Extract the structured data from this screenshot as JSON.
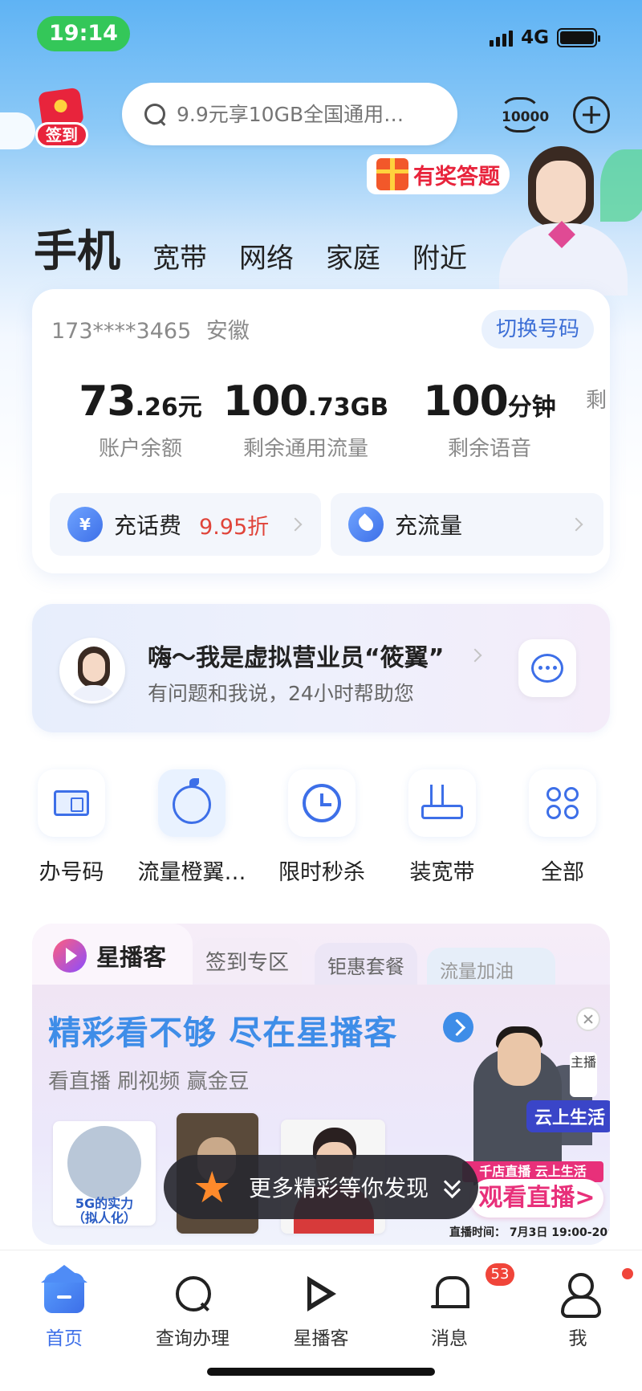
{
  "status_bar": {
    "time": "19:14",
    "network": "4G"
  },
  "header": {
    "checkin_label": "签到",
    "search_placeholder": "9.9元享10GB全国通用…",
    "hotline_label": "10000",
    "quiz_label": "有奖答题"
  },
  "top_tabs": [
    {
      "label": "手机",
      "active": true
    },
    {
      "label": "宽带"
    },
    {
      "label": "网络"
    },
    {
      "label": "家庭"
    },
    {
      "label": "附近"
    }
  ],
  "account": {
    "phone": "173****3465",
    "region": "安徽",
    "switch_label": "切换号码",
    "stats": [
      {
        "big": "73",
        "small": ".26元",
        "label": "账户余额"
      },
      {
        "big": "100",
        "small": ".73GB",
        "label": "剩余通用流量"
      },
      {
        "big": "100",
        "small": "分钟",
        "label": "剩余语音"
      },
      {
        "big": "",
        "small": "",
        "label": "剩"
      }
    ],
    "actions": [
      {
        "icon": "yuan-icon",
        "icon_text": "¥",
        "label": "充话费",
        "discount": "9.95折"
      },
      {
        "icon": "drop-icon",
        "label": "充流量"
      }
    ]
  },
  "virtual_agent": {
    "title": "嗨～我是虚拟营业员“筱翼”",
    "subtitle": "有问题和我说，24小时帮助您"
  },
  "services": [
    {
      "icon": "sim-card-icon",
      "label": "办号码"
    },
    {
      "icon": "orange-icon",
      "label": "流量橙翼…"
    },
    {
      "icon": "clock-icon",
      "label": "限时秒杀"
    },
    {
      "icon": "router-icon",
      "label": "装宽带"
    },
    {
      "icon": "grid-icon",
      "label": "全部"
    }
  ],
  "live": {
    "brand": "星播客",
    "tabs": [
      "签到专区",
      "钜惠套餐",
      "流量加油"
    ],
    "headline": "精彩看不够 尽在星播客",
    "subline": "看直播 刷视频 赢金豆",
    "thumb1_caption": "5G的实力\n（拟人化）",
    "promo": {
      "host_badge": "主播",
      "cloud_tag": "云上生活",
      "banner": "千店直播  云上生活",
      "watch_label": "观看直播>",
      "time_text": "直播时间：  7月3日 19:00-20:30"
    },
    "discover_label": "更多精彩等你发现"
  },
  "bottom_nav": [
    {
      "label": "首页",
      "icon": "home-icon",
      "active": true
    },
    {
      "label": "查询办理",
      "icon": "query-icon"
    },
    {
      "label": "星播客",
      "icon": "xingboke-icon"
    },
    {
      "label": "消息",
      "icon": "bell-icon",
      "badge": "53"
    },
    {
      "label": "我",
      "icon": "user-icon"
    }
  ],
  "colors": {
    "accent": "#3d6fe8",
    "discount": "#e0443a",
    "badge": "#f0453a",
    "status_pill": "#34c759"
  }
}
